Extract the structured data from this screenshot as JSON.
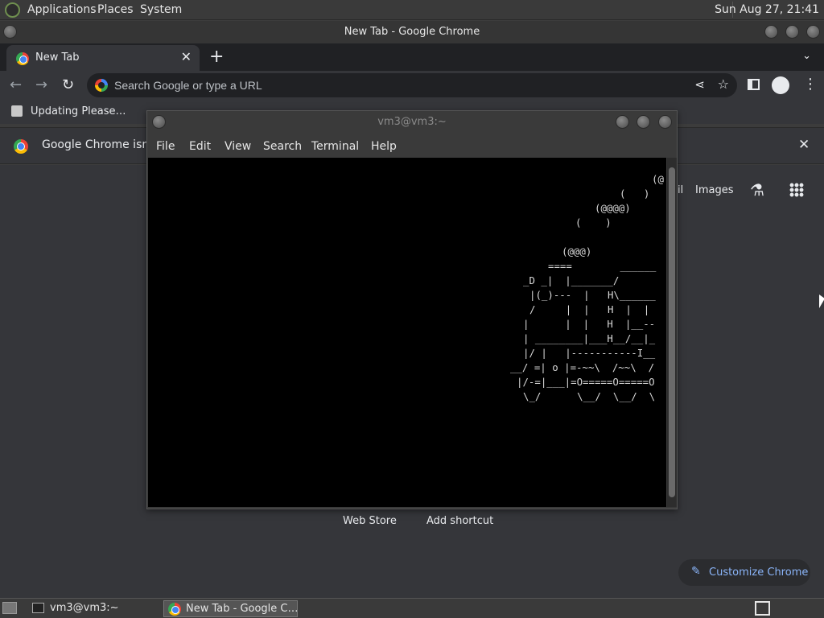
{
  "top_panel": {
    "menus": [
      "Applications",
      "Places",
      "System"
    ],
    "clock": "Sun Aug 27, 21:41"
  },
  "chrome": {
    "window_title": "New Tab - Google Chrome",
    "tab_title": "New Tab",
    "omnibox_placeholder": "Search Google or type a URL",
    "bookmark_label": "Updating Please…",
    "infobar_text": "Google Chrome isn't y",
    "ntp": {
      "gmail_partial": "il",
      "images_label": "Images",
      "web_store_label": "Web Store",
      "add_shortcut_label": "Add shortcut",
      "customize_label": "Customize Chrome"
    }
  },
  "terminal": {
    "title": "vm3@vm3:~",
    "menu": [
      "File",
      "Edit",
      "View",
      "Search",
      "Terminal",
      "Help"
    ],
    "ascii_lines": [
      "(@",
      "(   )",
      "(@@@@)",
      "(    )",
      "",
      "(@@@)",
      "====        ______",
      "_D _|  |_______/",
      "|(_)---  |   H\\______",
      "/     |  |   H  |  |",
      "|      |  |   H  |__--",
      "| ________|___H__/__|_",
      "|/ |   |-----------I__",
      "__/ =| o |=-~~\\  /~~\\  /",
      "|/-=|___|=O=====O=====O",
      "\\_/      \\__/  \\__/  \\"
    ]
  },
  "taskbar": {
    "items": [
      "vm3@vm3:~",
      "New Tab - Google C…"
    ]
  },
  "colors": {
    "chrome_dark": "#35363a",
    "accent_blue": "#8ab4f8",
    "terminal_bg": "#000000"
  }
}
